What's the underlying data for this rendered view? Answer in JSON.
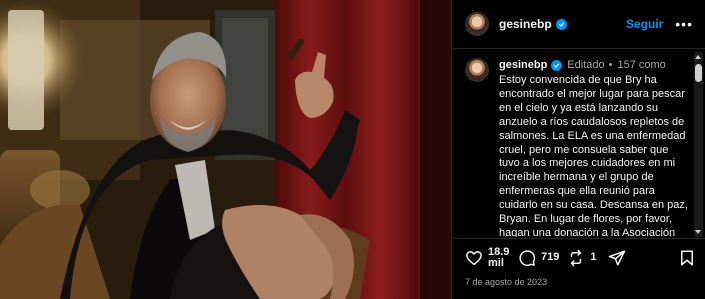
{
  "post": {
    "username": "gesinebp",
    "follow_label": "Seguir",
    "more_label": "•••",
    "edited_label": "Editado",
    "separator": "•",
    "time_label": "157 como",
    "caption": "Estoy convencida de que Bry ha encontrado el mejor lugar para pescar en el cielo y ya está lanzando su anzuelo a ríos caudalosos repletos de salmones. La ELA es una enfermedad cruel, pero me consuela saber que tuvo a los mejores cuidadores en mi increíble hermana y el grupo de enfermeras que ella reunió para cuidarlo en su casa. Descansa en paz, Bryan. En lugar de flores, por favor, hagan una donación a la Asociación de El Angel Hospital General de",
    "date": "7 de agosto de 2023"
  },
  "actions": {
    "likes_line1": "18.9",
    "likes_line2": "mil",
    "comments": "719",
    "reposts": "1"
  },
  "icons": {
    "verified": "verified-badge-icon",
    "like": "heart-icon",
    "comment": "comment-bubble-icon",
    "repost": "repost-icon",
    "share": "share-paper-plane-icon",
    "save": "bookmark-icon"
  },
  "colors": {
    "background": "#000000",
    "accent": "#0095f6",
    "text": "#f5f5f5",
    "muted": "#a8a8a8"
  }
}
